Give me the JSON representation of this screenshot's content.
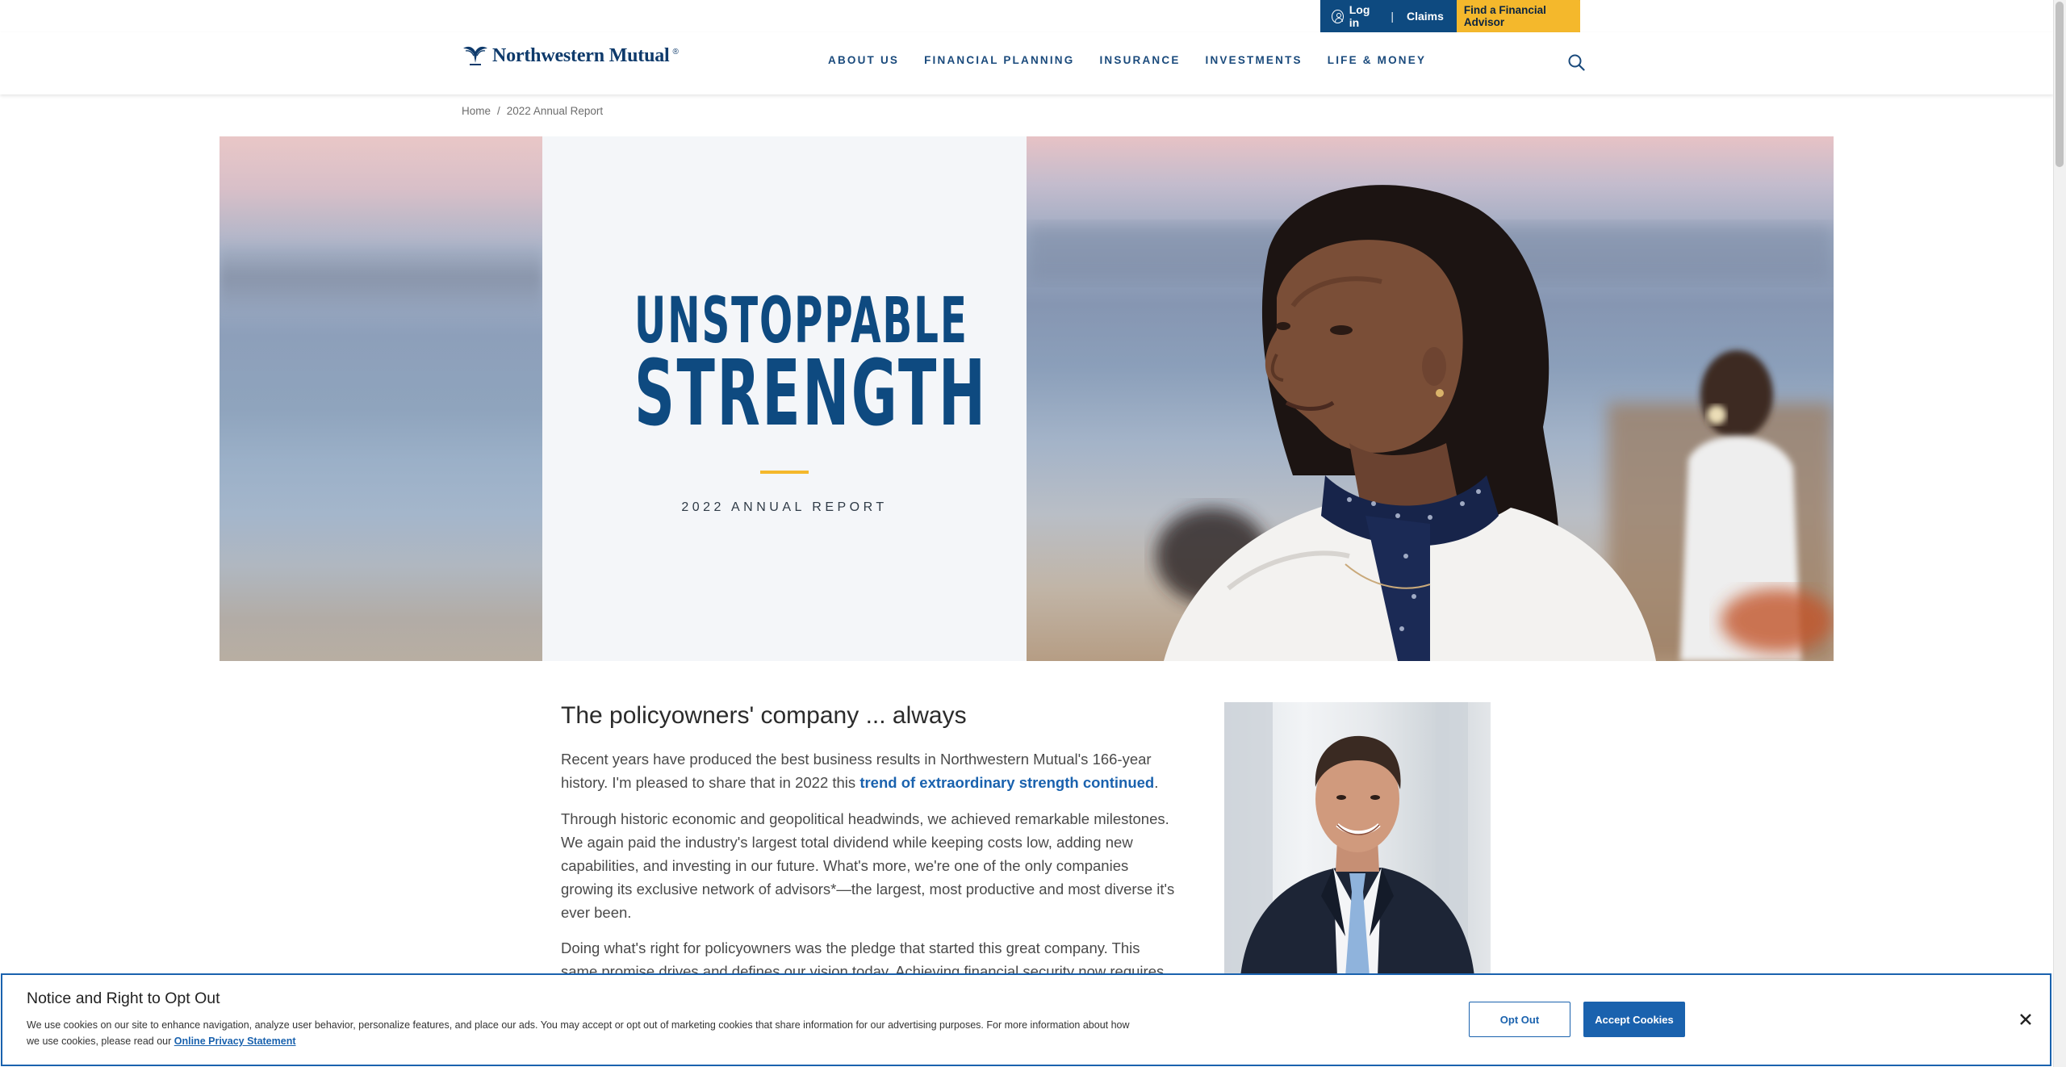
{
  "utility_bar": {
    "login_label": "Log in",
    "separator": "|",
    "claims_label": "Claims",
    "advisor_label": "Find a Financial Advisor"
  },
  "header": {
    "logo_text": "Northwestern Mutual",
    "logo_mark": "®",
    "nav": [
      "ABOUT US",
      "FINANCIAL PLANNING",
      "INSURANCE",
      "INVESTMENTS",
      "LIFE & MONEY"
    ]
  },
  "breadcrumb": {
    "home": "Home",
    "separator": "/",
    "current": "2022 Annual Report"
  },
  "hero": {
    "title_line1": "UNSTOPPABLE",
    "title_line2": "STRENGTH",
    "subtitle": "2022 ANNUAL REPORT"
  },
  "article": {
    "title": "The policyowners' company ... always",
    "p1_before": "Recent years have produced the best business results in Northwestern Mutual's 166-year history. I'm pleased to share that in 2022 this ",
    "p1_link": "trend of extraordinary strength continued",
    "p1_after": ".",
    "p2": "Through historic economic and geopolitical headwinds, we achieved remarkable milestones. We again paid the industry's largest total dividend while keeping costs low, adding new capabilities, and investing in our future. What's more, we're one of the only companies growing its exclusive network of advisors*—the largest, most productive and most diverse it's ever been.",
    "p3": "Doing what's right for policyowners was the pledge that started this great company. This same promise drives and defines our vision today. Achieving financial security now requires"
  },
  "cookie_banner": {
    "title": "Notice and Right to Opt Out",
    "text": "We use cookies on our site to enhance navigation, analyze user behavior, personalize features, and place our ads. You may accept or opt out of marketing cookies that share information for our advertising purposes. For more information about how we use cookies, please read our ",
    "link": "Online Privacy Statement",
    "opt_out_label": "Opt Out",
    "accept_label": "Accept Cookies"
  },
  "icons": {
    "user": "user-circle-icon",
    "search": "search-icon",
    "close": "close-icon",
    "logo": "eagle-logo-icon"
  },
  "colors": {
    "brand_blue": "#0e4a80",
    "link_blue": "#1a62ae",
    "accent_gold": "#f4b82c"
  }
}
